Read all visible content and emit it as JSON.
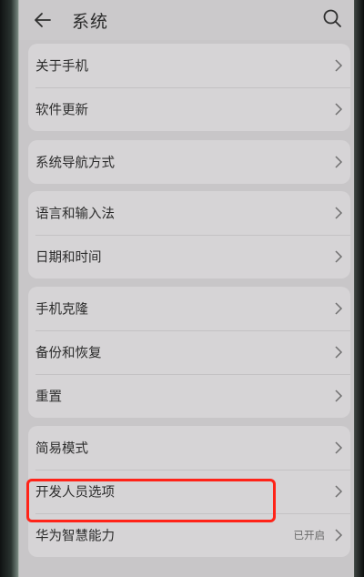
{
  "header": {
    "title": "系统",
    "back_icon": "arrow-left-icon",
    "search_icon": "search-icon"
  },
  "groups": [
    {
      "items": [
        {
          "label": "关于手机"
        },
        {
          "label": "软件更新"
        }
      ]
    },
    {
      "items": [
        {
          "label": "系统导航方式"
        }
      ]
    },
    {
      "items": [
        {
          "label": "语言和输入法"
        },
        {
          "label": "日期和时间"
        }
      ]
    },
    {
      "items": [
        {
          "label": "手机克隆"
        },
        {
          "label": "备份和恢复"
        },
        {
          "label": "重置"
        }
      ]
    },
    {
      "items": [
        {
          "label": "简易模式"
        },
        {
          "label": "开发人员选项"
        },
        {
          "label": "华为智慧能力",
          "value": "已开启"
        }
      ]
    }
  ],
  "annotation": {
    "highlight_color": "#ff2318",
    "highlighted_item": "开发人员选项"
  }
}
